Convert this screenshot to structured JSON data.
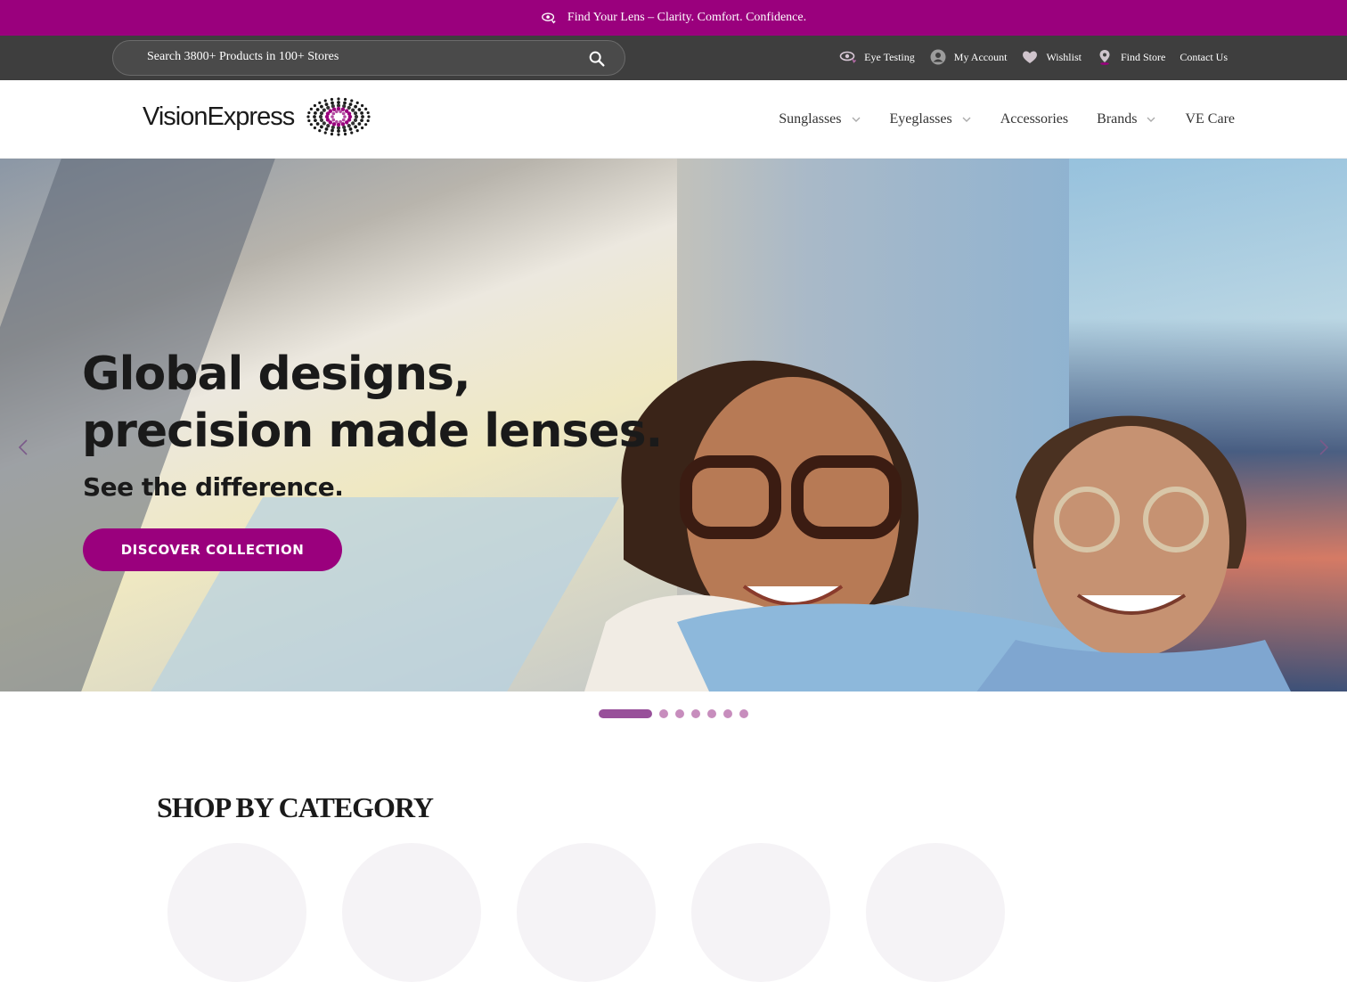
{
  "promo": {
    "text": "Find Your Lens – Clarity. Comfort. Confidence.",
    "icon": "eye-icon"
  },
  "search": {
    "placeholder": "Search 3800+ Products in 100+ Stores",
    "icon": "search-icon"
  },
  "utility_links": [
    {
      "label": "Eye Testing",
      "icon": "eye-test-icon"
    },
    {
      "label": "My Account",
      "icon": "user-icon"
    },
    {
      "label": "Wishlist",
      "icon": "heart-icon"
    },
    {
      "label": "Find Store",
      "icon": "location-pin-icon"
    },
    {
      "label": "Contact Us"
    }
  ],
  "logo": {
    "text": "VisionExpress",
    "icon": "dotted-eye-logo"
  },
  "nav": [
    {
      "label": "Sunglasses",
      "has_dropdown": true
    },
    {
      "label": "Eyeglasses",
      "has_dropdown": true
    },
    {
      "label": "Accessories",
      "has_dropdown": false
    },
    {
      "label": "Brands",
      "has_dropdown": true
    },
    {
      "label": "VE Care",
      "has_dropdown": false
    }
  ],
  "hero": {
    "title_line1": "Global designs,",
    "title_line2": "precision made lenses.",
    "subtitle": "See the difference.",
    "cta": "DISCOVER COLLECTION",
    "slide_count": 7,
    "active_slide": 1
  },
  "category": {
    "title": "SHOP BY CATEGORY",
    "count": 5
  },
  "colors": {
    "brand": "#9a007d",
    "utility_bg": "#3e3e3e",
    "dot_active": "#98509a",
    "dot": "#c78dbd"
  }
}
